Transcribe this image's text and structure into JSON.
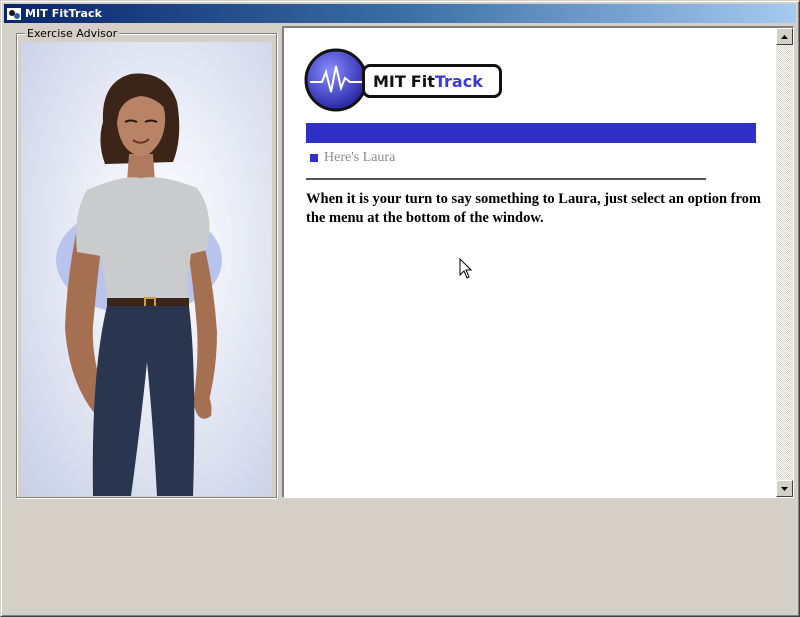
{
  "window": {
    "title": "MIT FitTrack"
  },
  "advisor": {
    "group_label": "Exercise Advisor"
  },
  "content": {
    "logo": {
      "mit": "MIT",
      "fit": "Fit",
      "track": "Track"
    },
    "subtitle": "Here's Laura",
    "body": "When it is your turn to say something to Laura, just select an option from the menu at the bottom of the window."
  },
  "colors": {
    "title_bar": "#0a246a",
    "accent_blue": "#3030c8",
    "logo_track": "#3a3ad6",
    "window_face": "#d4d0c8"
  },
  "icons": {
    "title": "app-icon",
    "scroll_up": "arrow-up-icon",
    "scroll_down": "arrow-down-icon",
    "pointer": "mouse-pointer-icon"
  }
}
